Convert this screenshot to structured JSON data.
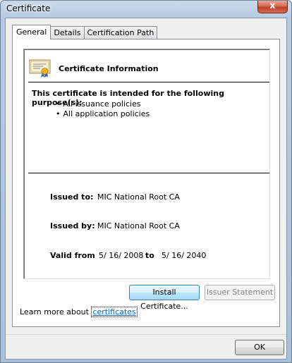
{
  "window": {
    "title": "Certificate",
    "close_label": "x"
  },
  "tabs": [
    {
      "label": "General",
      "active": true
    },
    {
      "label": "Details",
      "active": false
    },
    {
      "label": "Certification Path",
      "active": false
    }
  ],
  "info": {
    "heading": "Certificate Information",
    "purpose_title": "This certificate is intended for the following purpose(s):",
    "purposes": [
      "All issuance policies",
      "All application policies"
    ],
    "issued_to_label": "Issued to:",
    "issued_to": "MIC National Root CA",
    "issued_by_label": "Issued by:",
    "issued_by": "MIC National Root CA",
    "valid_from_label": "Valid from",
    "valid_from": "5/ 16/ 2008",
    "valid_to_label": "to",
    "valid_to": "5/ 16/ 2040"
  },
  "buttons": {
    "install": "Install Certificate...",
    "issuer_statement": "Issuer Statement",
    "ok": "OK"
  },
  "learn_more": {
    "prefix": "Learn more about ",
    "link": "certificates"
  },
  "icons": {
    "certificate": "certificate-icon",
    "close": "close-icon"
  }
}
